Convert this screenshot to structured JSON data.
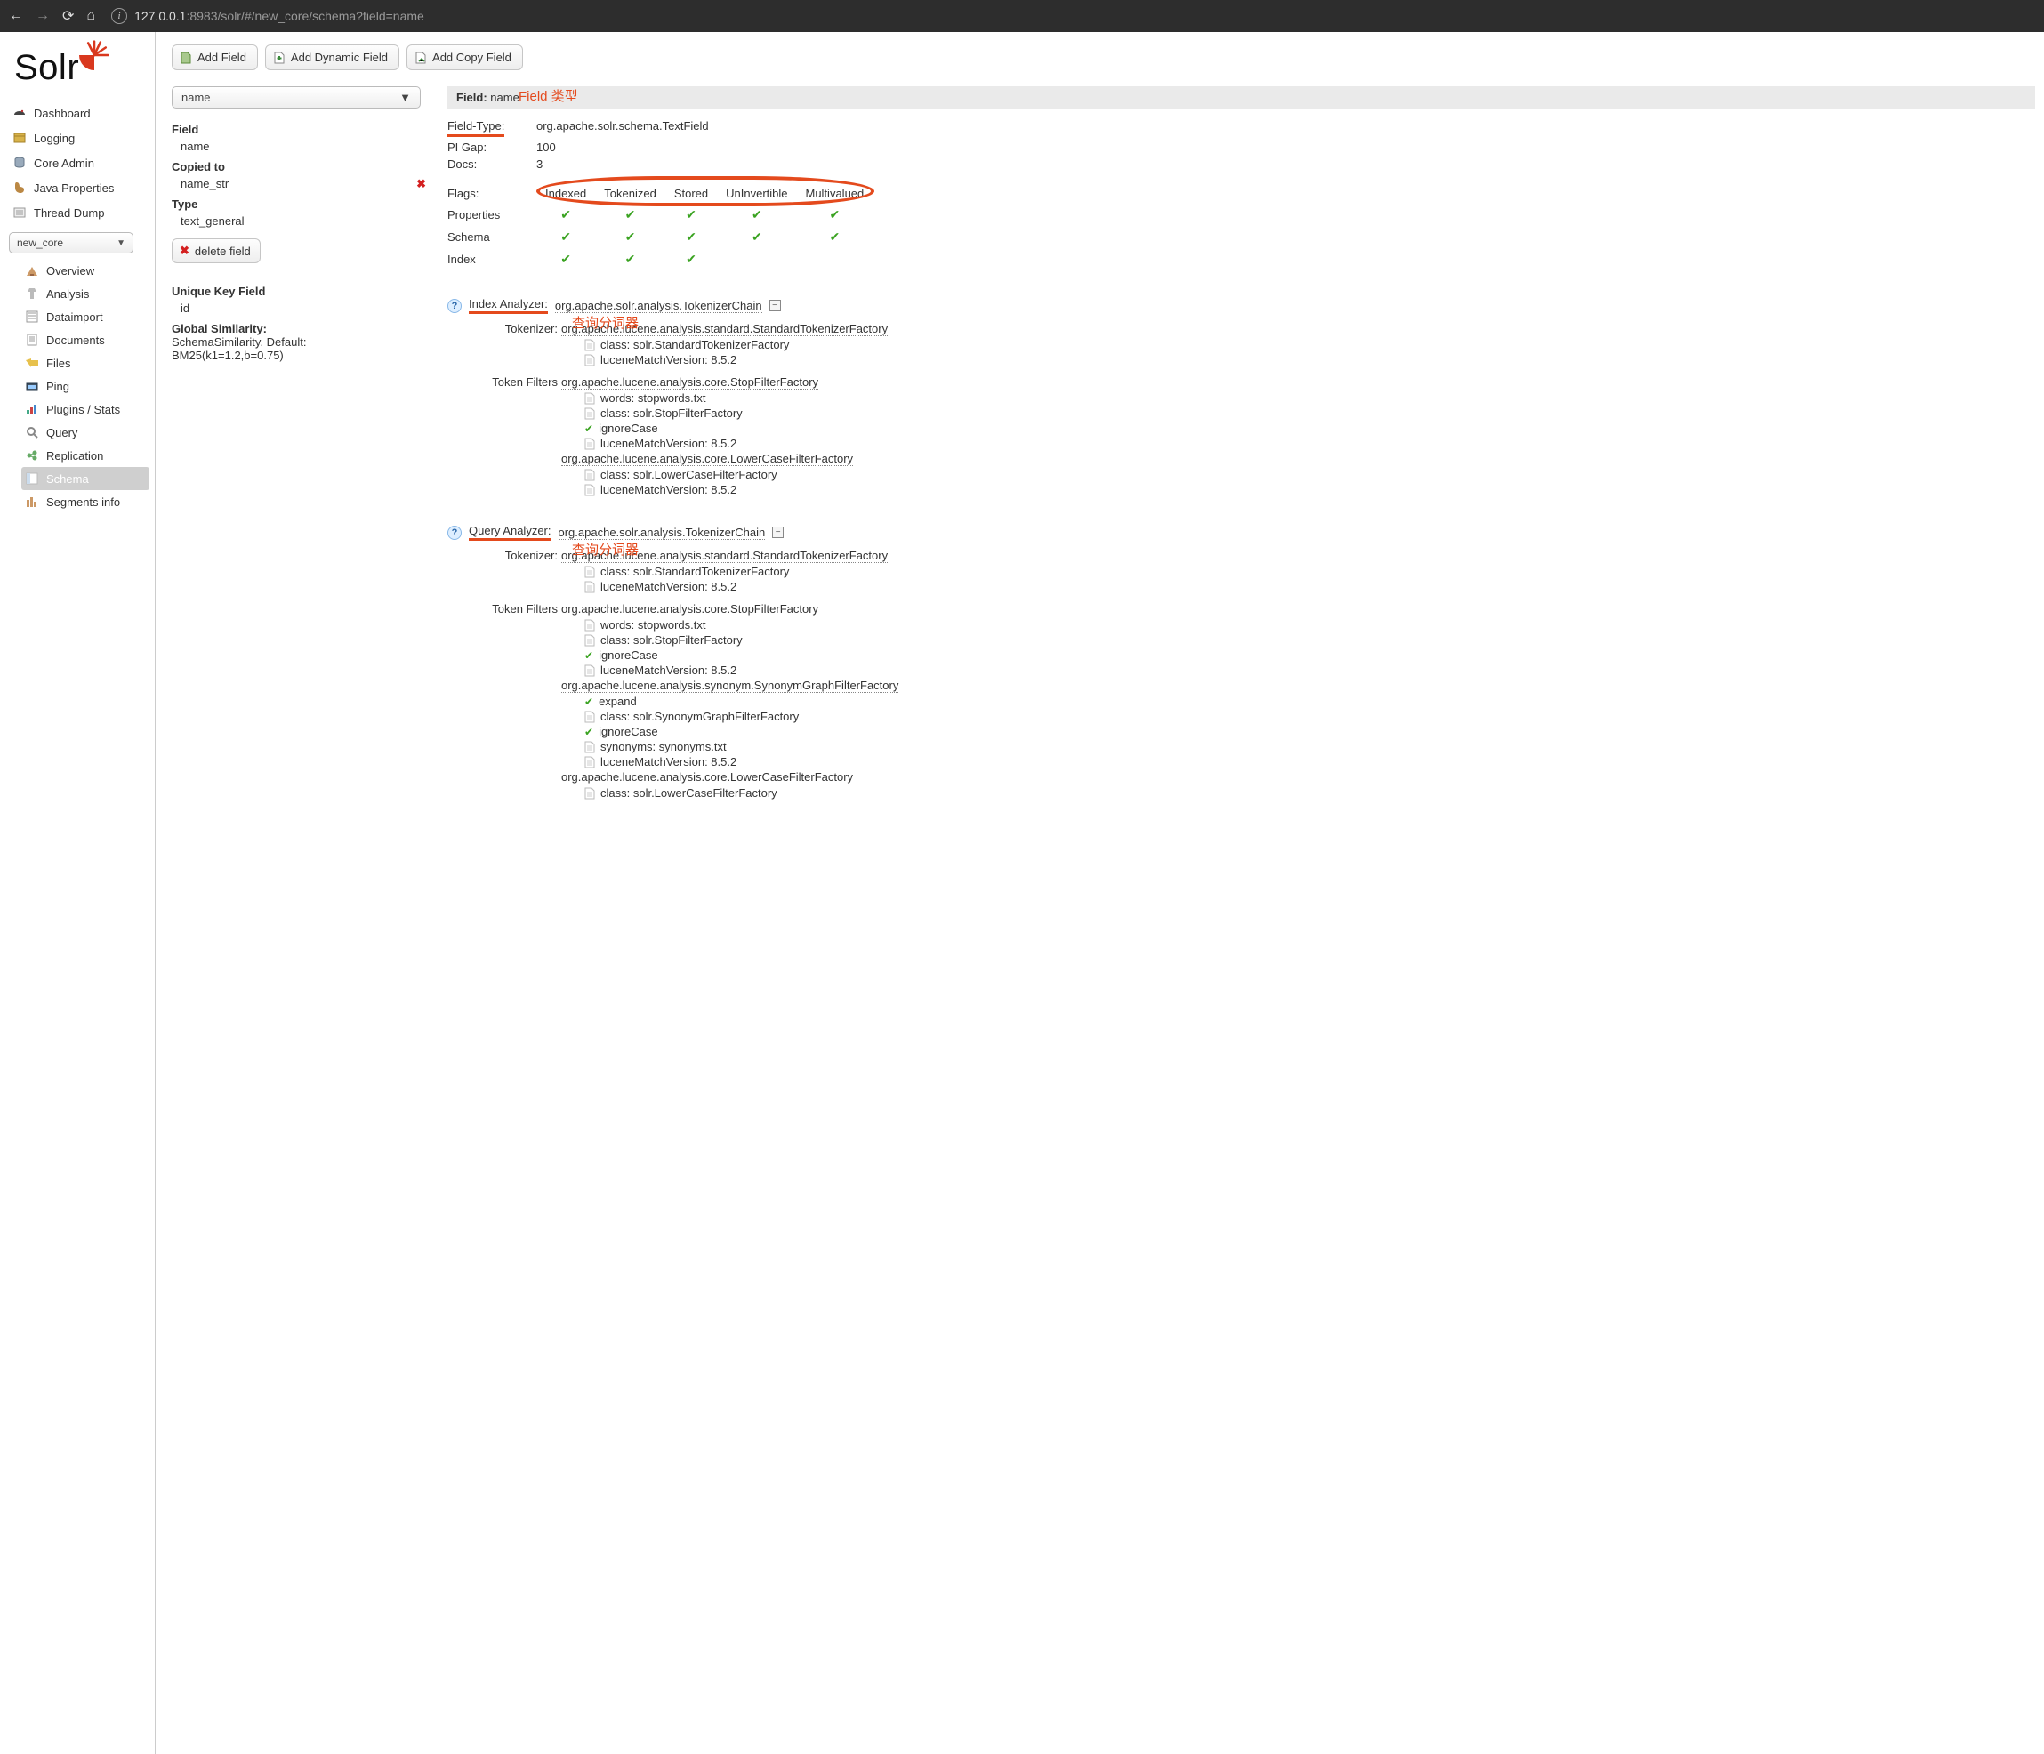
{
  "browser": {
    "url_host": "127.0.0.1",
    "url_port": ":8983",
    "url_path": "/solr/#/new_core/schema?field=name"
  },
  "logo_text": "Solr",
  "sidebar": {
    "main": [
      {
        "label": "Dashboard"
      },
      {
        "label": "Logging"
      },
      {
        "label": "Core Admin"
      },
      {
        "label": "Java Properties"
      },
      {
        "label": "Thread Dump"
      }
    ],
    "core_selected": "new_core",
    "core_items": [
      {
        "label": "Overview"
      },
      {
        "label": "Analysis"
      },
      {
        "label": "Dataimport"
      },
      {
        "label": "Documents"
      },
      {
        "label": "Files"
      },
      {
        "label": "Ping"
      },
      {
        "label": "Plugins / Stats"
      },
      {
        "label": "Query"
      },
      {
        "label": "Replication"
      },
      {
        "label": "Schema"
      },
      {
        "label": "Segments info"
      }
    ]
  },
  "buttons": {
    "add_field": "Add Field",
    "add_dynamic_field": "Add Dynamic Field",
    "add_copy_field": "Add Copy Field",
    "delete_field": "delete field"
  },
  "field_select": "name",
  "mid": {
    "field_lbl": "Field",
    "field_val": "name",
    "copied_lbl": "Copied to",
    "copied_val": "name_str",
    "type_lbl": "Type",
    "type_val": "text_general",
    "uniq_lbl": "Unique Key Field",
    "uniq_val": "id",
    "sim_lbl": "Global Similarity:",
    "sim_v1": "SchemaSimilarity. Default:",
    "sim_v2": "BM25(k1=1.2,b=0.75)"
  },
  "detail": {
    "header_lbl": "Field:",
    "header_val": "name",
    "rows": {
      "ft_k": "Field-Type:",
      "ft_v": "org.apache.solr.schema.TextField",
      "pi_k": "PI Gap:",
      "pi_v": "100",
      "docs_k": "Docs:",
      "docs_v": "3",
      "flags_k": "Flags:"
    },
    "flag_cols": [
      "Indexed",
      "Tokenized",
      "Stored",
      "UnInvertible",
      "Multivalued"
    ],
    "flag_rows": [
      {
        "name": "Properties",
        "vals": [
          true,
          true,
          true,
          true,
          true
        ]
      },
      {
        "name": "Schema",
        "vals": [
          true,
          true,
          true,
          true,
          true
        ]
      },
      {
        "name": "Index",
        "vals": [
          true,
          true,
          true,
          false,
          false
        ]
      }
    ]
  },
  "annotations": {
    "field_type": "Field 类型",
    "analyzer": "查询分词器"
  },
  "analyzers": [
    {
      "title": "Index Analyzer:",
      "class": "org.apache.solr.analysis.TokenizerChain",
      "tokenizer": {
        "label": "Tokenizer:",
        "class": "org.apache.lucene.analysis.standard.StandardTokenizerFactory",
        "props": [
          {
            "t": "doc",
            "k": "class:",
            "v": "solr.StandardTokenizerFactory"
          },
          {
            "t": "doc",
            "k": "luceneMatchVersion:",
            "v": "8.5.2"
          }
        ]
      },
      "filters": {
        "label": "Token Filters",
        "groups": [
          {
            "class": "org.apache.lucene.analysis.core.StopFilterFactory",
            "props": [
              {
                "t": "doc",
                "k": "words:",
                "v": "stopwords.txt"
              },
              {
                "t": "doc",
                "k": "class:",
                "v": "solr.StopFilterFactory"
              },
              {
                "t": "chk",
                "k": "ignoreCase",
                "v": ""
              },
              {
                "t": "doc",
                "k": "luceneMatchVersion:",
                "v": "8.5.2"
              }
            ]
          },
          {
            "class": "org.apache.lucene.analysis.core.LowerCaseFilterFactory",
            "props": [
              {
                "t": "doc",
                "k": "class:",
                "v": "solr.LowerCaseFilterFactory"
              },
              {
                "t": "doc",
                "k": "luceneMatchVersion:",
                "v": "8.5.2"
              }
            ]
          }
        ]
      }
    },
    {
      "title": "Query Analyzer:",
      "class": "org.apache.solr.analysis.TokenizerChain",
      "tokenizer": {
        "label": "Tokenizer:",
        "class": "org.apache.lucene.analysis.standard.StandardTokenizerFactory",
        "props": [
          {
            "t": "doc",
            "k": "class:",
            "v": "solr.StandardTokenizerFactory"
          },
          {
            "t": "doc",
            "k": "luceneMatchVersion:",
            "v": "8.5.2"
          }
        ]
      },
      "filters": {
        "label": "Token Filters",
        "groups": [
          {
            "class": "org.apache.lucene.analysis.core.StopFilterFactory",
            "props": [
              {
                "t": "doc",
                "k": "words:",
                "v": "stopwords.txt"
              },
              {
                "t": "doc",
                "k": "class:",
                "v": "solr.StopFilterFactory"
              },
              {
                "t": "chk",
                "k": "ignoreCase",
                "v": ""
              },
              {
                "t": "doc",
                "k": "luceneMatchVersion:",
                "v": "8.5.2"
              }
            ]
          },
          {
            "class": "org.apache.lucene.analysis.synonym.SynonymGraphFilterFactory",
            "props": [
              {
                "t": "chk",
                "k": "expand",
                "v": ""
              },
              {
                "t": "doc",
                "k": "class:",
                "v": "solr.SynonymGraphFilterFactory"
              },
              {
                "t": "chk",
                "k": "ignoreCase",
                "v": ""
              },
              {
                "t": "doc",
                "k": "synonyms:",
                "v": "synonyms.txt"
              },
              {
                "t": "doc",
                "k": "luceneMatchVersion:",
                "v": "8.5.2"
              }
            ]
          },
          {
            "class": "org.apache.lucene.analysis.core.LowerCaseFilterFactory",
            "props": [
              {
                "t": "doc",
                "k": "class:",
                "v": "solr.LowerCaseFilterFactory"
              }
            ]
          }
        ]
      }
    }
  ]
}
